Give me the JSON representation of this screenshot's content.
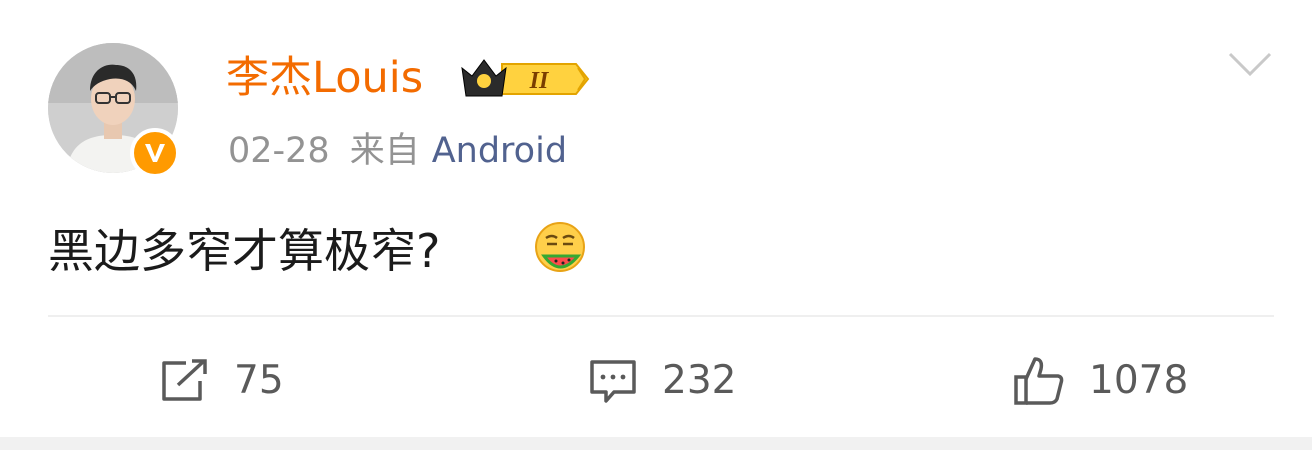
{
  "post": {
    "username": "李杰Louis",
    "rank_badge": "II",
    "date": "02-28",
    "from_label": "来自",
    "source": "Android",
    "text": "黑边多窄才算极窄?",
    "emoji": "eating-watermelon-emoji"
  },
  "actions": {
    "repost": {
      "icon": "share-icon",
      "count": "75"
    },
    "comment": {
      "icon": "comment-icon",
      "count": "232"
    },
    "like": {
      "icon": "thumbs-up-icon",
      "count": "1078"
    }
  },
  "icons": {
    "menu": "chevron-down-icon",
    "verified": "verified-v-badge-icon",
    "rank": "crown-rank-badge"
  },
  "colors": {
    "username": "#f36b00",
    "source": "#51628f",
    "meta": "#939393",
    "text": "#1b1b1b",
    "verified": "#ff9a00",
    "icon_gray": "#5a5a5a"
  }
}
